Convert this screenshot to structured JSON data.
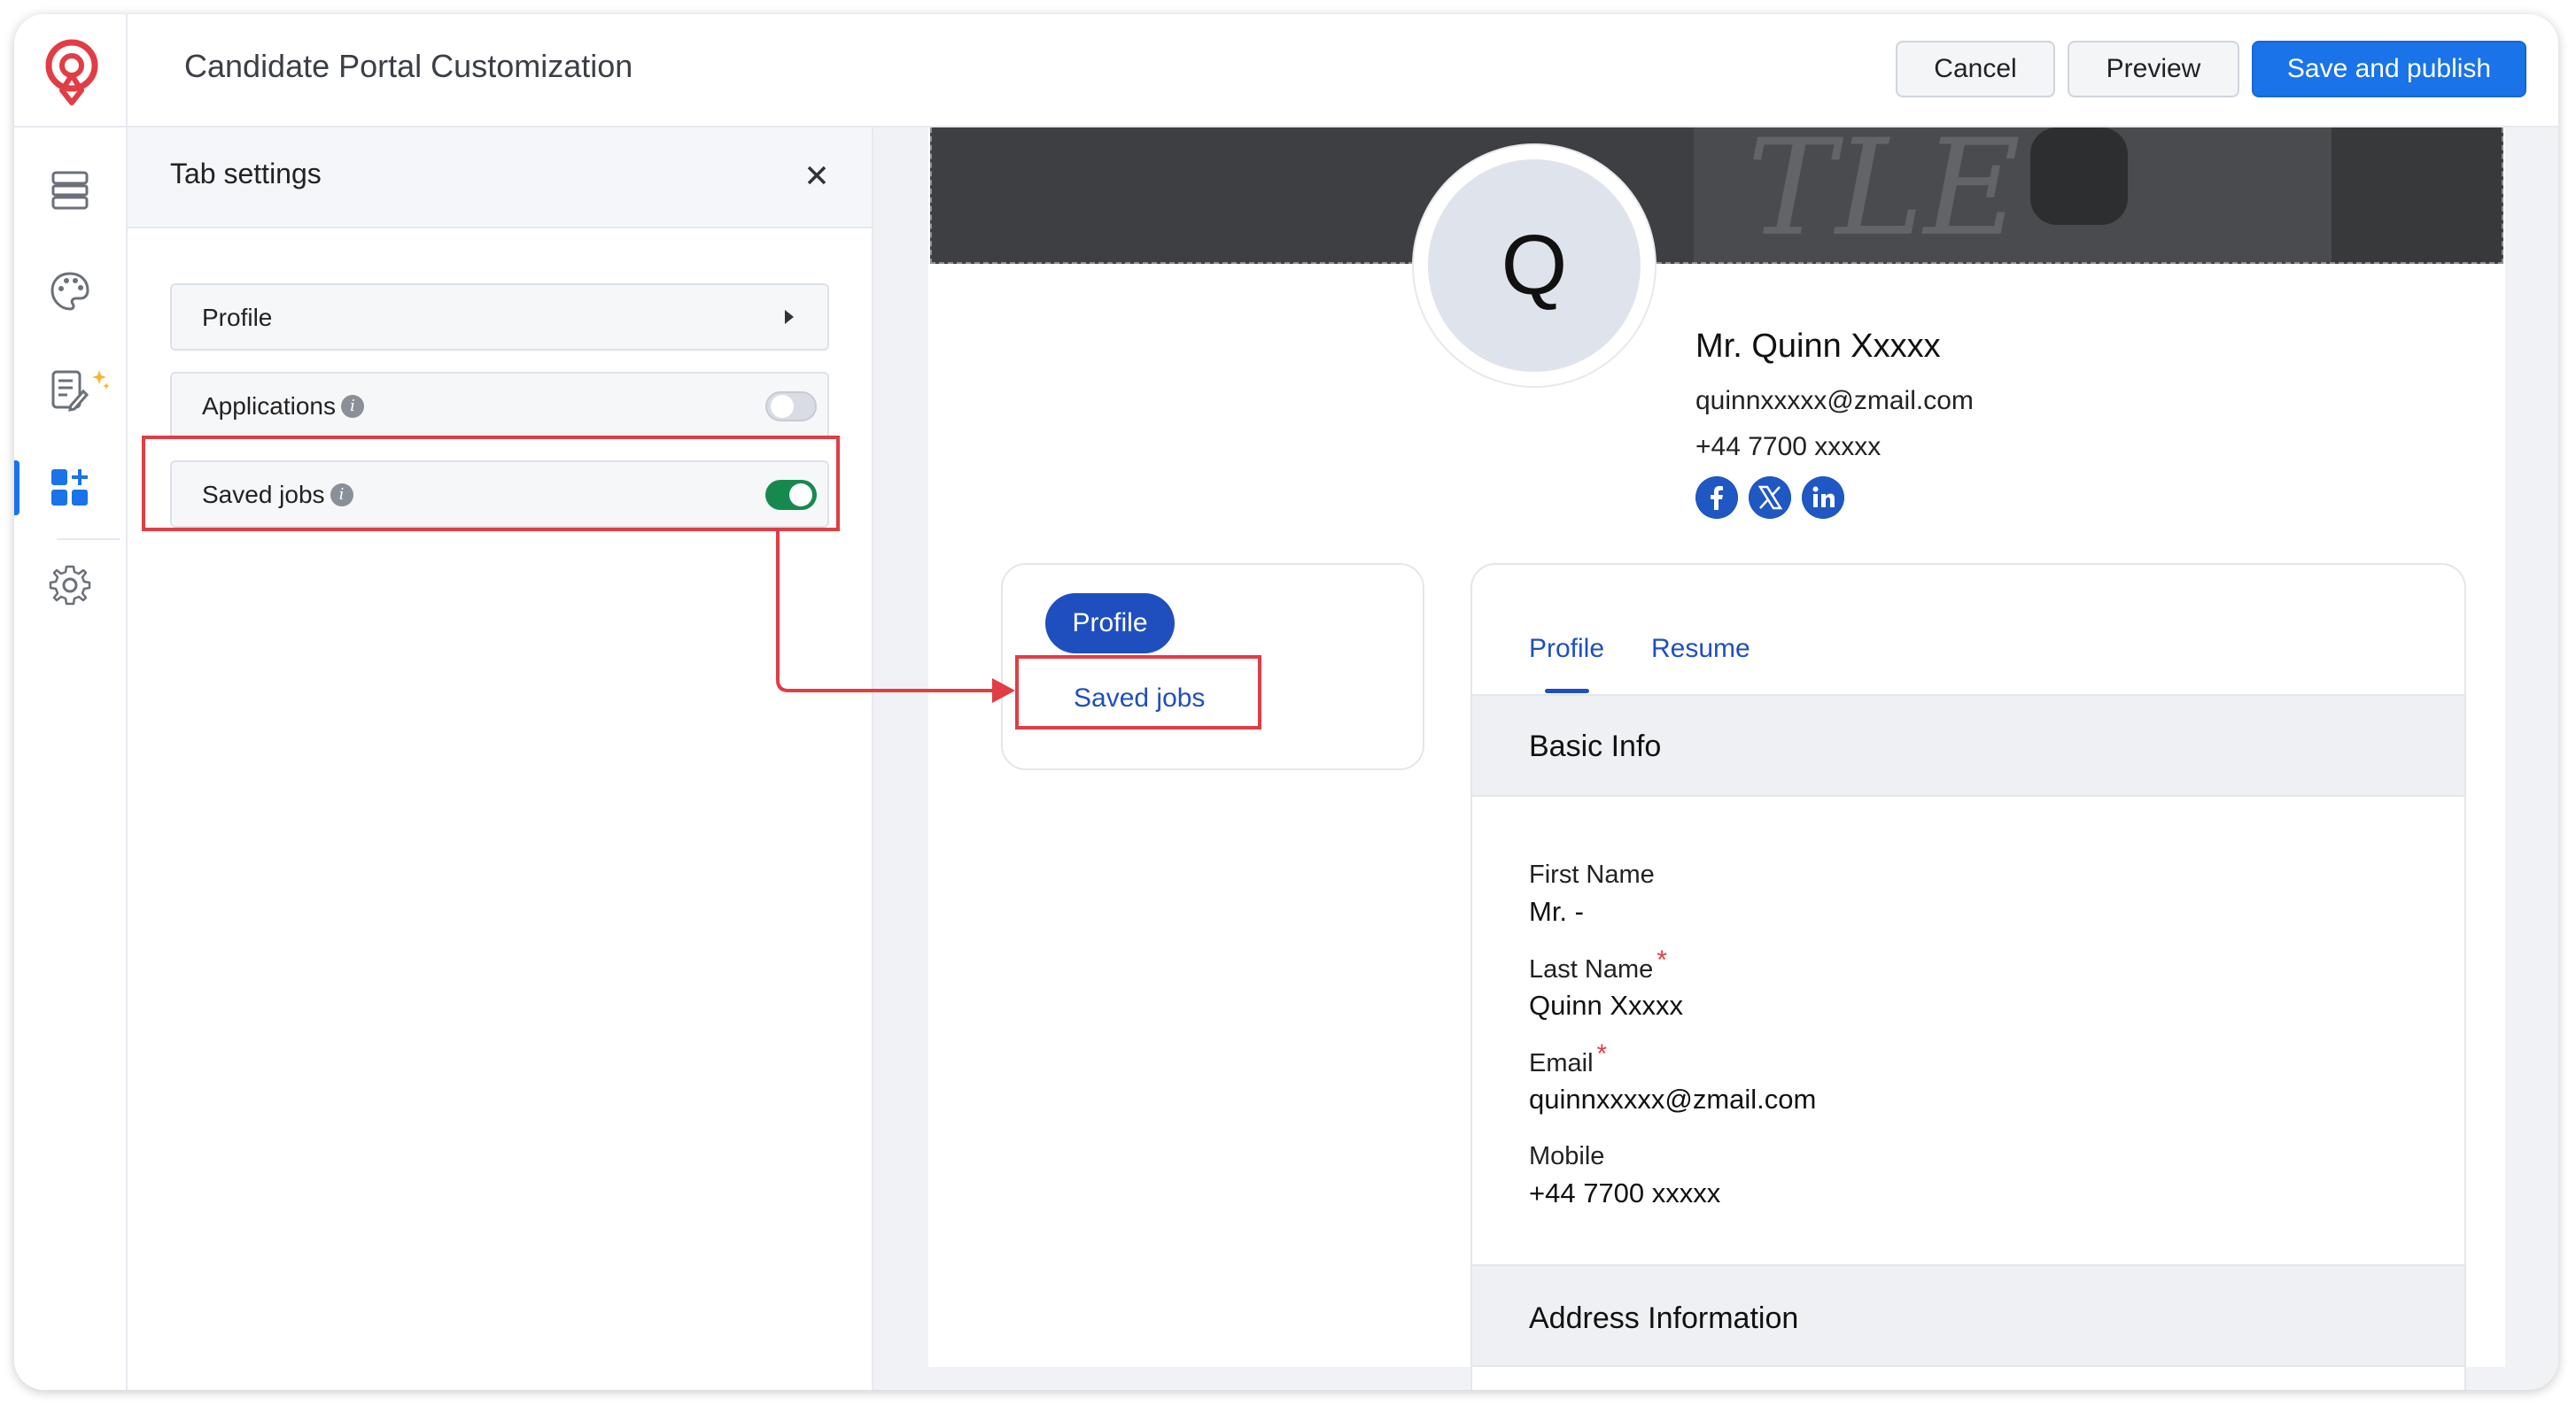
{
  "header": {
    "title": "Candidate Portal Customization",
    "cancel_label": "Cancel",
    "preview_label": "Preview",
    "save_label": "Save and publish"
  },
  "rail": {
    "items": [
      {
        "icon": "layout-sections-icon",
        "active": false
      },
      {
        "icon": "palette-icon",
        "active": false
      },
      {
        "icon": "ai-form-icon",
        "active": false
      },
      {
        "icon": "add-widgets-icon",
        "active": true
      },
      {
        "icon": "gear-icon",
        "active": false
      }
    ]
  },
  "panel": {
    "title": "Tab settings",
    "tabs": [
      {
        "label": "Profile",
        "control": "expand"
      },
      {
        "label": "Applications",
        "info": true,
        "enabled": false
      },
      {
        "label": "Saved jobs",
        "info": true,
        "enabled": true
      }
    ]
  },
  "preview": {
    "avatar_letter": "Q",
    "name": "Mr. Quinn Xxxxx",
    "email": "quinnxxxxx@zmail.com",
    "phone": "+44 7700 xxxxx",
    "social": [
      "facebook-icon",
      "x-twitter-icon",
      "linkedin-icon"
    ],
    "nav": {
      "active": "Profile",
      "items": [
        "Profile",
        "Saved jobs"
      ]
    },
    "detail_tabs": [
      "Profile",
      "Resume"
    ],
    "basic_info_title": "Basic Info",
    "fields": [
      {
        "label": "First Name",
        "value": "Mr. -",
        "required": false
      },
      {
        "label": "Last Name",
        "value": "Quinn Xxxxx",
        "required": true
      },
      {
        "label": "Email",
        "value": "quinnxxxxx@zmail.com",
        "required": true
      },
      {
        "label": "Mobile",
        "value": "+44 7700 xxxxx",
        "required": false
      }
    ],
    "address_title": "Address Information",
    "required_mark": "*"
  },
  "colors": {
    "accent": "#1a73e8",
    "portal_blue": "#1f4fbf",
    "highlight_red": "#e03d45",
    "toggle_on": "#168a4e"
  }
}
